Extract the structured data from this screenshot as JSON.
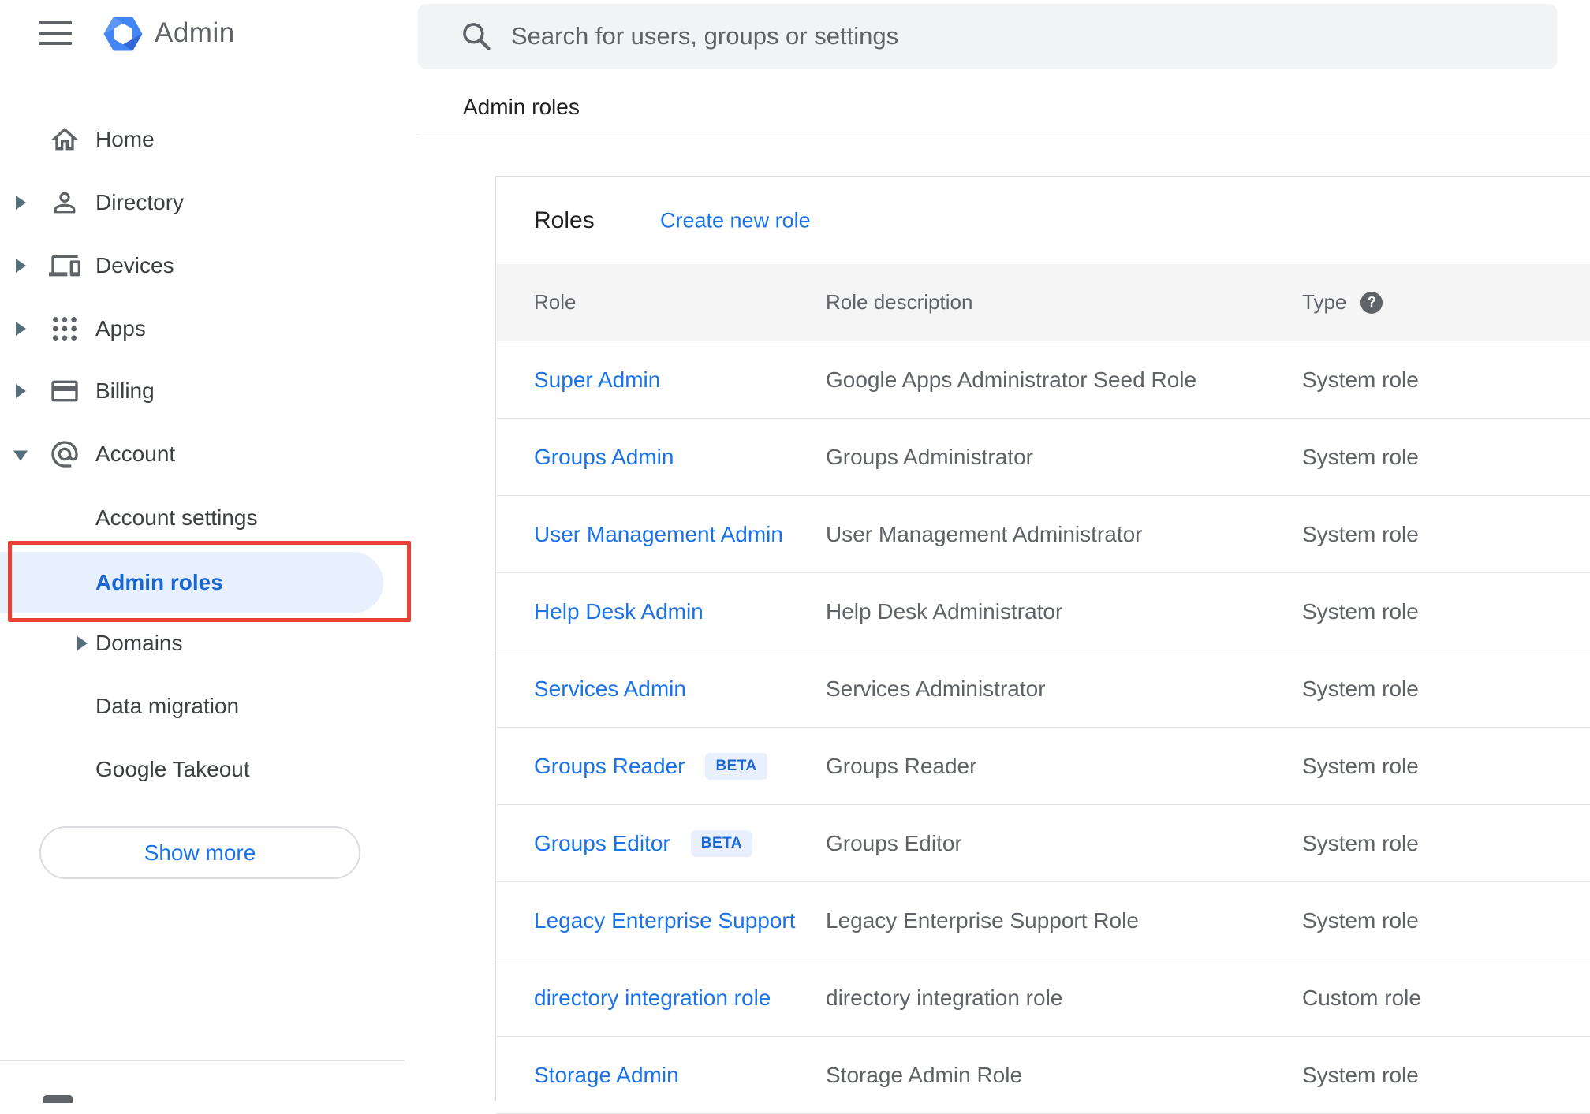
{
  "app": {
    "product": "Admin"
  },
  "search": {
    "placeholder": "Search for users, groups or settings"
  },
  "breadcrumb": {
    "label": "Admin roles"
  },
  "sidebar": {
    "items": [
      {
        "label": "Home"
      },
      {
        "label": "Directory"
      },
      {
        "label": "Devices"
      },
      {
        "label": "Apps"
      },
      {
        "label": "Billing"
      },
      {
        "label": "Account"
      }
    ],
    "account_children": [
      {
        "label": "Account settings"
      },
      {
        "label": "Admin roles",
        "selected": true
      },
      {
        "label": "Domains"
      },
      {
        "label": "Data migration"
      },
      {
        "label": "Google Takeout"
      }
    ],
    "show_more": "Show more"
  },
  "roles_panel": {
    "title": "Roles",
    "create_link": "Create new role",
    "beta_label": "BETA",
    "columns": {
      "role": "Role",
      "description": "Role description",
      "type": "Type"
    },
    "rows": [
      {
        "role": "Super Admin",
        "description": "Google Apps Administrator Seed Role",
        "type": "System role"
      },
      {
        "role": "Groups Admin",
        "description": "Groups Administrator",
        "type": "System role"
      },
      {
        "role": "User Management Admin",
        "description": "User Management Administrator",
        "type": "System role"
      },
      {
        "role": "Help Desk Admin",
        "description": "Help Desk Administrator",
        "type": "System role"
      },
      {
        "role": "Services Admin",
        "description": "Services Administrator",
        "type": "System role"
      },
      {
        "role": "Groups Reader",
        "beta": true,
        "description": "Groups Reader",
        "type": "System role"
      },
      {
        "role": "Groups Editor",
        "beta": true,
        "description": "Groups Editor",
        "type": "System role"
      },
      {
        "role": "Legacy Enterprise Support",
        "description": "Legacy Enterprise Support Role",
        "type": "System role"
      },
      {
        "role": "directory integration role",
        "description": "directory integration role",
        "type": "Custom role"
      },
      {
        "role": "Storage Admin",
        "description": "Storage Admin Role",
        "type": "System role"
      }
    ]
  },
  "colors": {
    "accent_blue": "#1a73e8",
    "selected_nav_text": "#1967d2",
    "selected_nav_bg": "#e8f0fe",
    "annotation_red": "#e94235",
    "beta_bg": "#e8f0fe",
    "beta_text": "#1967d2",
    "table_header_bg": "#f5f5f5",
    "search_bg": "#f1f3f4"
  }
}
